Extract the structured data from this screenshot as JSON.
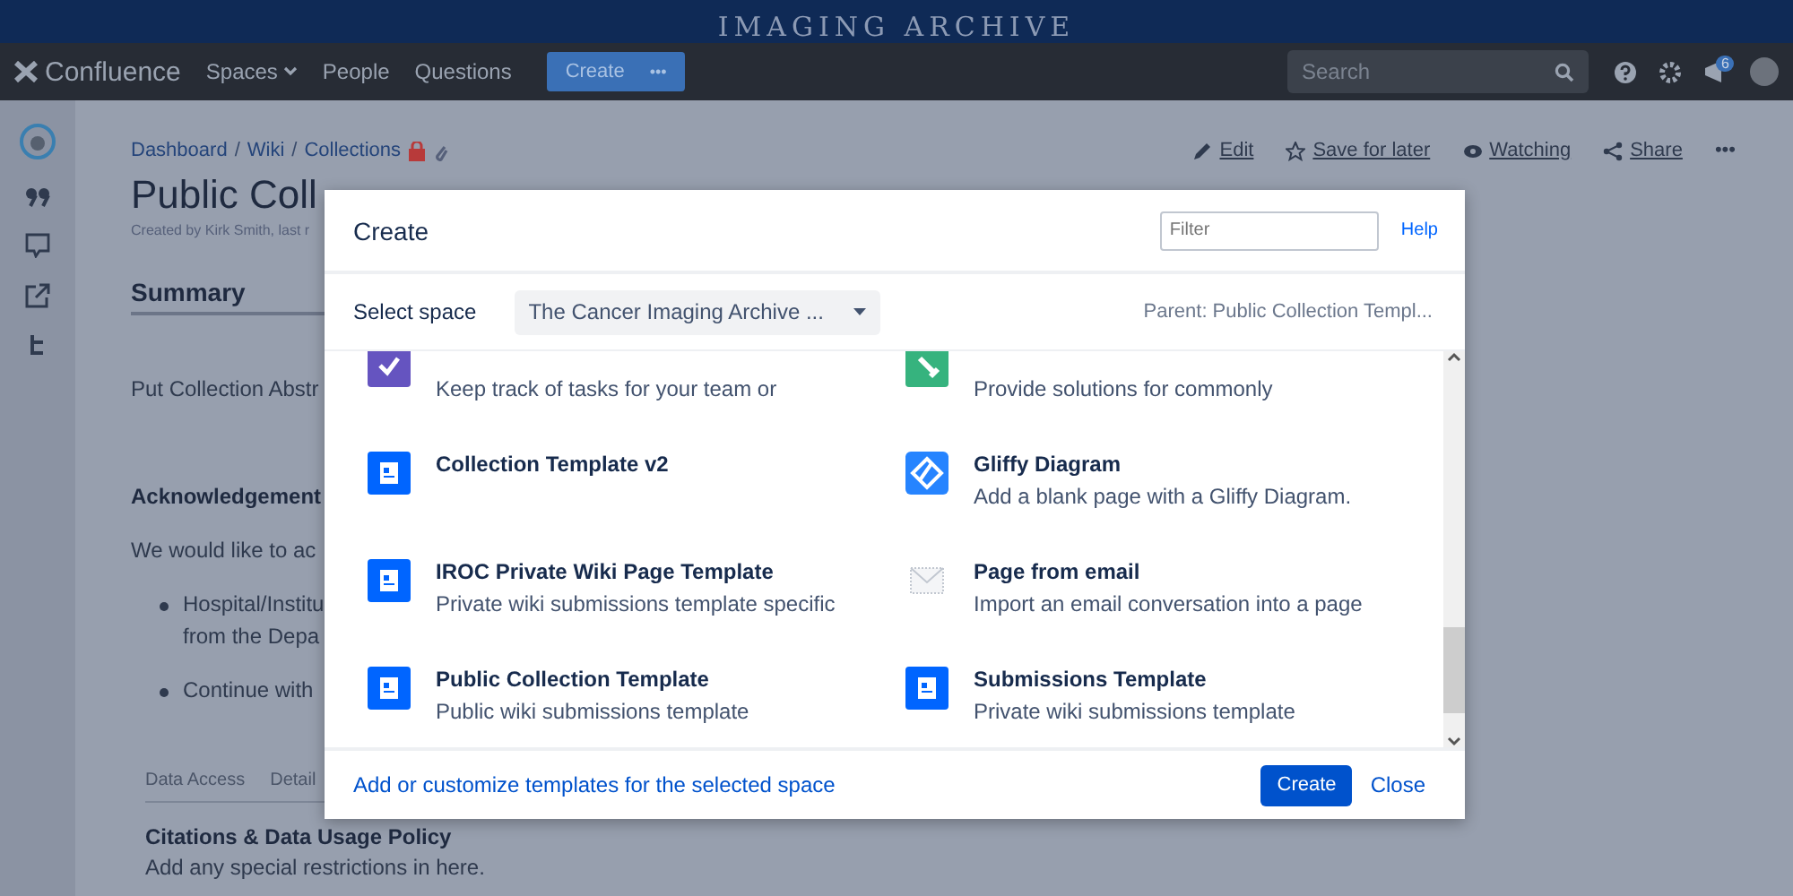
{
  "banner": {
    "title": "IMAGING ARCHIVE"
  },
  "nav": {
    "logo": "Confluence",
    "items": [
      {
        "label": "Spaces",
        "dropdown": true
      },
      {
        "label": "People",
        "dropdown": false
      },
      {
        "label": "Questions",
        "dropdown": false
      }
    ],
    "create": "Create",
    "more": "•••",
    "search": {
      "placeholder": "Search"
    },
    "notifications": "6"
  },
  "page": {
    "breadcrumbs": [
      "Dashboard",
      "Wiki",
      "Collections"
    ],
    "separator": "/",
    "actions": [
      {
        "kind": "edit",
        "label": "Edit"
      },
      {
        "kind": "star",
        "label": "Save for later"
      },
      {
        "kind": "eye",
        "label": "Watching"
      },
      {
        "kind": "share",
        "label": "Share"
      },
      {
        "kind": "more",
        "label": "•••"
      }
    ],
    "title": "Public Coll",
    "byline": "Created by Kirk Smith, last r",
    "summary": "Summary",
    "abstract": "Put Collection Abstr",
    "ack_heading": "Acknowledgement",
    "ack_text": "We would like to ac",
    "bullets": [
      {
        "lines": [
          "Hospital/Institu",
          "from the Depa"
        ]
      },
      {
        "lines": [
          "Continue with"
        ]
      }
    ],
    "tabs": [
      "Data Access",
      "Detail"
    ],
    "policy_heading": "Citations & Data Usage Policy",
    "policy_text": "Add any special restrictions in here."
  },
  "dialog": {
    "title": "Create",
    "filter": {
      "placeholder": "Filter"
    },
    "help": "Help",
    "space_label": "Select space",
    "space_value": "The Cancer Imaging Archive ...",
    "parent": "Parent: Public Collection Templ...",
    "templates": [
      {
        "kind": "tasks",
        "description": "Keep track of tasks for your team or"
      },
      {
        "kind": "howto",
        "description": "Provide solutions for commonly"
      },
      {
        "kind": "page",
        "title": "Collection Template v2"
      },
      {
        "kind": "gliffy",
        "title": "Gliffy Diagram",
        "description": "Add a blank page with a Gliffy Diagram."
      },
      {
        "kind": "page",
        "title": "IROC Private Wiki Page Template",
        "description": "Private wiki submissions template specific"
      },
      {
        "kind": "email",
        "title": "Page from email",
        "description": "Import an email conversation into a page"
      },
      {
        "kind": "page",
        "title": "Public Collection Template",
        "description": "Public wiki submissions template"
      },
      {
        "kind": "page",
        "title": "Submissions Template",
        "description": "Private wiki submissions template"
      }
    ],
    "customize_link": "Add or customize templates for the selected space",
    "create_button": "Create",
    "close_button": "Close"
  }
}
